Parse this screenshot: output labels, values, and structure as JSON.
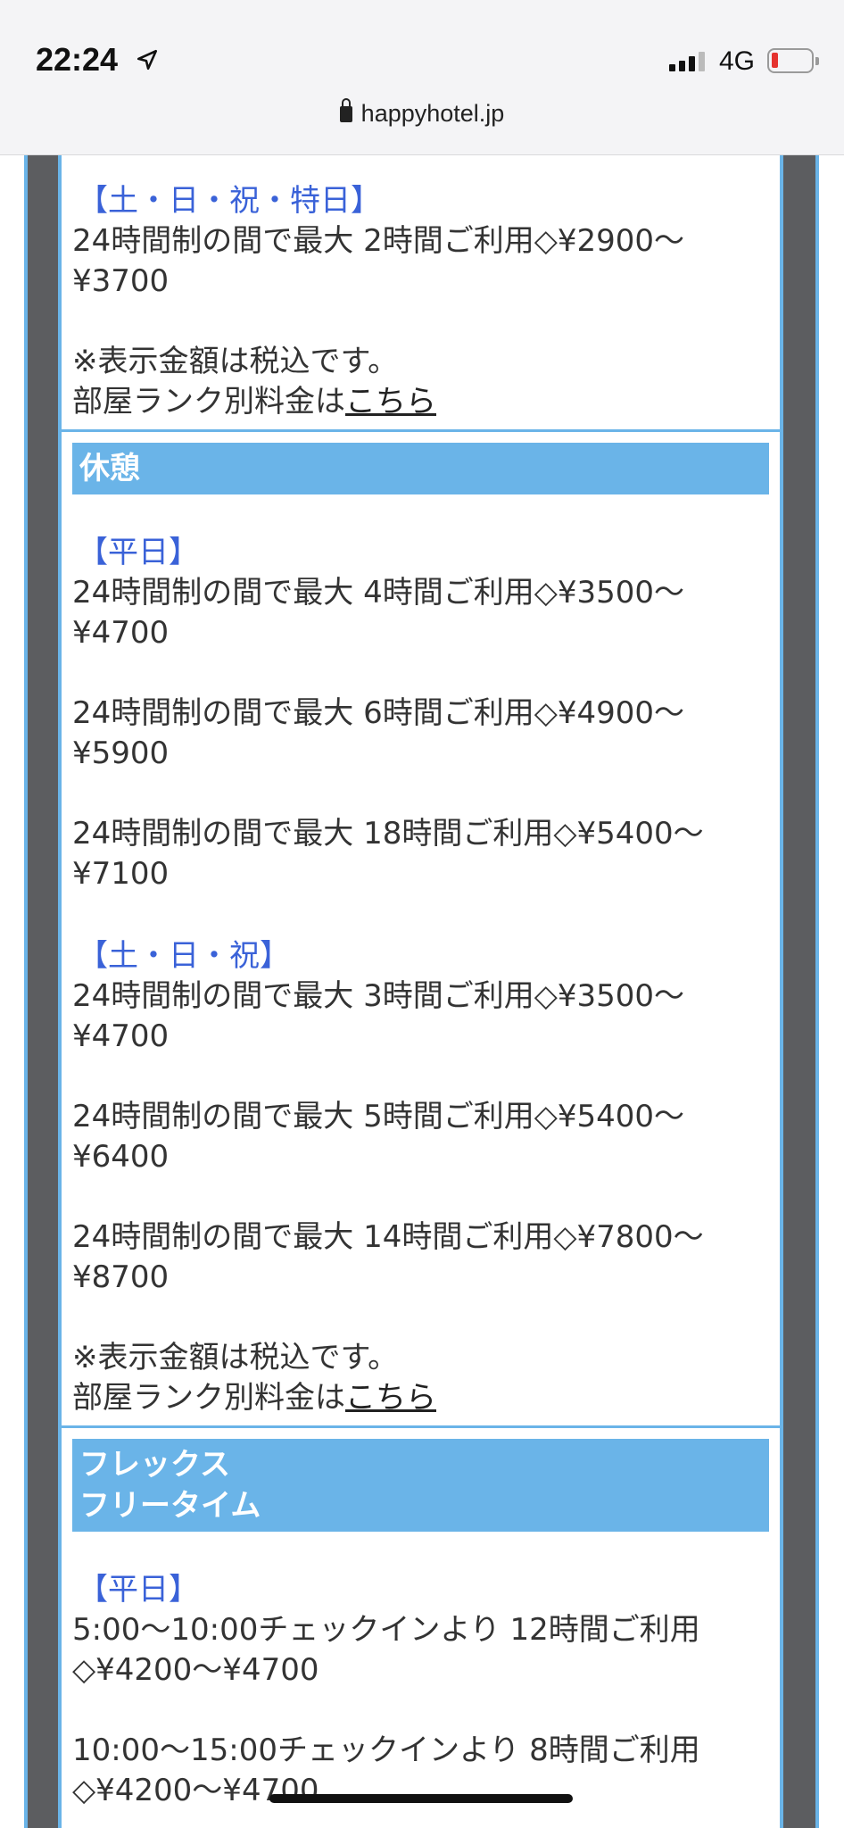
{
  "status": {
    "time": "22:24",
    "network": "4G",
    "url": "happyhotel.jp"
  },
  "sections": [
    {
      "id": "stay-partial",
      "blocks": [
        {
          "label": "【土・日・祝・特日】",
          "lines": [
            "24時間制の間で最大 2時間ご利用◇¥2900〜",
            "¥3700"
          ]
        }
      ],
      "note1": "※表示金額は税込です。",
      "note2_prefix": "部屋ランク別料金は",
      "note2_link": "こちら"
    },
    {
      "id": "rest",
      "title_lines": [
        "休憩"
      ],
      "groups": [
        {
          "label": "【平日】",
          "entries": [
            [
              "24時間制の間で最大 4時間ご利用◇¥3500〜",
              "¥4700"
            ],
            [
              "24時間制の間で最大 6時間ご利用◇¥4900〜",
              "¥5900"
            ],
            [
              "24時間制の間で最大 18時間ご利用◇¥5400〜",
              "¥7100"
            ]
          ]
        },
        {
          "label": "【土・日・祝】",
          "entries": [
            [
              "24時間制の間で最大 3時間ご利用◇¥3500〜",
              "¥4700"
            ],
            [
              "24時間制の間で最大 5時間ご利用◇¥5400〜",
              "¥6400"
            ],
            [
              "24時間制の間で最大 14時間ご利用◇¥7800〜",
              "¥8700"
            ]
          ]
        }
      ],
      "note1": "※表示金額は税込です。",
      "note2_prefix": "部屋ランク別料金は",
      "note2_link": "こちら"
    },
    {
      "id": "flex",
      "title_lines": [
        "フレックス",
        "フリータイム"
      ],
      "groups": [
        {
          "label": "【平日】",
          "entries": [
            [
              "5:00〜10:00チェックインより 12時間ご利用",
              "◇¥4200〜¥4700"
            ],
            [
              "10:00〜15:00チェックインより 8時間ご利用",
              "◇¥4200〜¥4700"
            ]
          ]
        }
      ]
    }
  ],
  "colors": {
    "accent": "#6ab4e8",
    "day_label": "#3a62d8",
    "frame_grey": "#5c5d60"
  }
}
